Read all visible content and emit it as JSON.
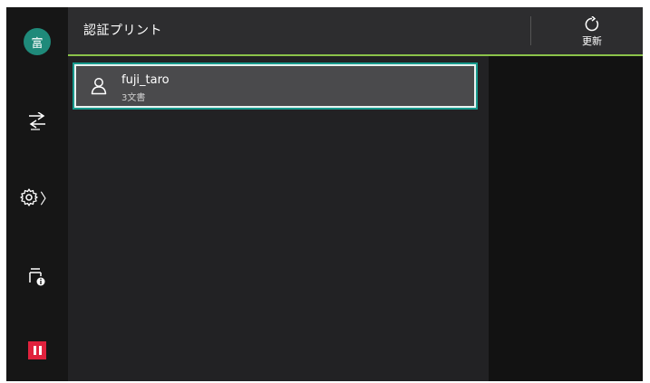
{
  "sidebar": {
    "avatar_label": "富",
    "items": [
      {
        "icon": "swap-icon"
      },
      {
        "icon": "gear-icon",
        "chevron": "〉"
      },
      {
        "icon": "printer-info-icon"
      },
      {
        "icon": "pause-icon"
      }
    ]
  },
  "header": {
    "title": "認証プリント",
    "refresh_label": "更新"
  },
  "list": {
    "items": [
      {
        "user": "fuji_taro",
        "count": "3文書"
      }
    ]
  },
  "colors": {
    "accent_teal": "#17998c",
    "accent_green": "#8bc34a",
    "pause_red": "#e0223d",
    "avatar_green": "#1f8a7a"
  }
}
